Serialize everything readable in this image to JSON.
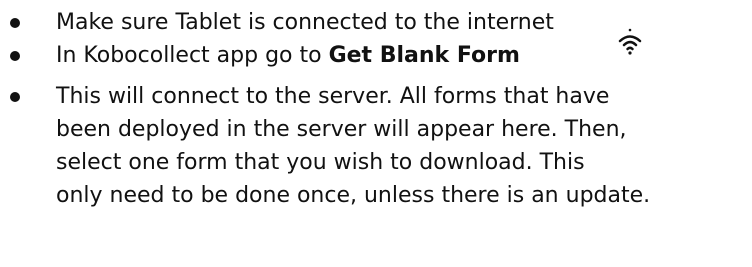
{
  "bullets": [
    {
      "text": "Make sure Tablet is connected to the internet"
    },
    {
      "text_before": "In Kobocollect app go to ",
      "text_bold": "Get Blank Form"
    },
    {
      "lines": [
        "This will connect to the server. All forms that have",
        "been deployed in the server will appear here. Then,",
        "select one form that you wish to download. This",
        "only need to be done once, unless there is an update."
      ]
    }
  ],
  "icons": {
    "wifi": "wifi-icon"
  },
  "colors": {
    "text": "#111111",
    "background": "#ffffff"
  }
}
